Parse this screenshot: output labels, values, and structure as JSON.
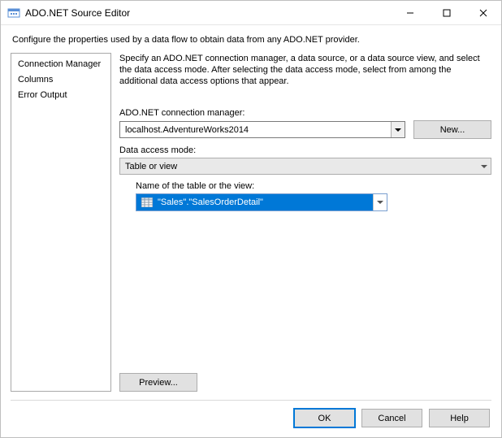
{
  "window": {
    "title": "ADO.NET Source Editor",
    "description": "Configure the properties used by a data flow to obtain data from any ADO.NET provider."
  },
  "sidebar": {
    "items": [
      {
        "label": "Connection Manager",
        "selected": true
      },
      {
        "label": "Columns",
        "selected": false
      },
      {
        "label": "Error Output",
        "selected": false
      }
    ]
  },
  "main": {
    "intro": "Specify an ADO.NET connection manager, a data source, or a data source view, and select the data access mode. After selecting the data access mode, select from among the additional data access options that appear.",
    "conn_label": "ADO.NET connection manager:",
    "conn_value": "localhost.AdventureWorks2014",
    "new_label": "New...",
    "access_label": "Data access mode:",
    "access_value": "Table or view",
    "table_label": "Name of the table or the view:",
    "table_value": "\"Sales\".\"SalesOrderDetail\"",
    "preview_label": "Preview..."
  },
  "footer": {
    "ok": "OK",
    "cancel": "Cancel",
    "help": "Help"
  }
}
